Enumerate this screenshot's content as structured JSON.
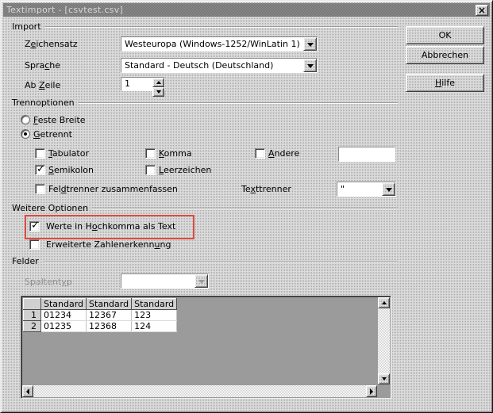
{
  "window": {
    "title": "Textimport - [csvtest.csv]"
  },
  "icons": {
    "close": "×"
  },
  "colors": {
    "highlight_red": "#de4c41",
    "titlebar_gray": "#808080",
    "dialog_face": "#d4d4d4"
  },
  "buttons": {
    "ok": "OK",
    "cancel": "Abbrechen",
    "help": "&Hilfe"
  },
  "import": {
    "group_label": "Import",
    "charset_label": "Z&eichensatz",
    "charset_value": "Westeuropa (Windows-1252/WinLatin 1)",
    "language_label": "Spra&che",
    "language_value": "Standard - Deutsch (Deutschland)",
    "from_row_label": "Ab &Zeile",
    "from_row_value": "1"
  },
  "separator_options": {
    "group_label": "Trennoptionen",
    "fixed_width": {
      "label": "&Feste Breite",
      "selected": false
    },
    "separated": {
      "label": "&Getrennt",
      "selected": true
    },
    "tabulator": {
      "label": "&Tabulator",
      "checked": false
    },
    "comma": {
      "label": "&Komma",
      "checked": false
    },
    "other": {
      "label": "&Andere",
      "checked": false,
      "value": ""
    },
    "semicolon": {
      "label": "&Semikolon",
      "checked": true
    },
    "space": {
      "label": "&Leerzeichen",
      "checked": false
    },
    "merge_delimiters": {
      "label": "Fel&dtrenner zusammenfassen",
      "checked": false
    },
    "text_delimiter_label": "Te&xttrenner",
    "text_delimiter_value": "\""
  },
  "other_options": {
    "group_label": "Weitere Optionen",
    "quoted_field_as_text": {
      "label": "Werte in H&ochkomma als Text",
      "checked": true
    },
    "detect_special_numbers": {
      "label": "Erweiterte Zahlenerkenn&ung",
      "checked": false
    }
  },
  "fields": {
    "group_label": "Felder",
    "column_type_label": "Spaltent&yp",
    "column_type_value": ""
  },
  "preview": {
    "column_headers": [
      "Standard",
      "Standard",
      "Standard"
    ],
    "rows": [
      {
        "num": "1",
        "cells": [
          "01234",
          "12367",
          "123"
        ]
      },
      {
        "num": "2",
        "cells": [
          "01235",
          "12368",
          "124"
        ]
      }
    ]
  }
}
